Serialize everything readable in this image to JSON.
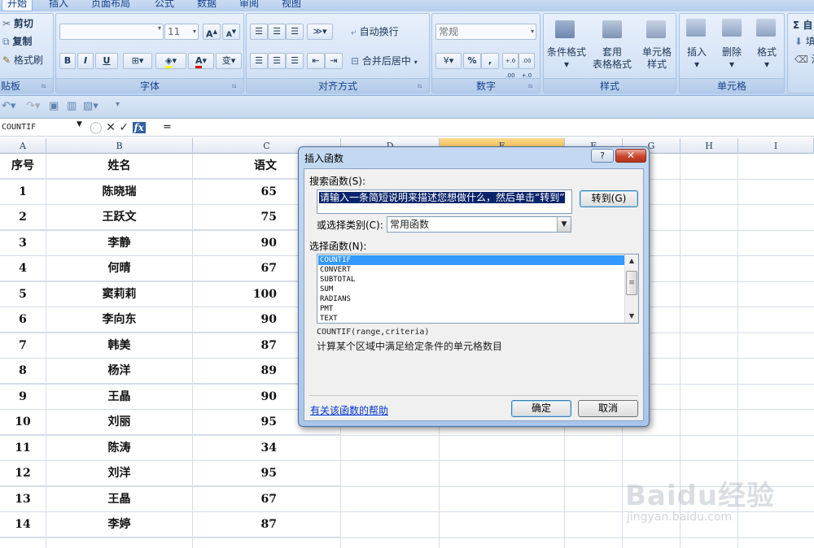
{
  "ribbon": {
    "tabs": [
      "开始",
      "插入",
      "页面布局",
      "公式",
      "数据",
      "审阅",
      "视图"
    ],
    "clipboard": {
      "cut": "剪切",
      "copy": "复制",
      "format_painter": "格式刷",
      "label": "贴板"
    },
    "font": {
      "label": "字体",
      "size": "11",
      "bold": "B",
      "italic": "I",
      "underline": "U",
      "grow": "A",
      "shrink": "A",
      "font_color": "A",
      "phonetic": "变"
    },
    "alignment": {
      "label": "对齐方式",
      "wrap_text": "自动换行",
      "merge_center": "合并后居中"
    },
    "number": {
      "label": "数字",
      "format": "常规",
      "percent": "%",
      "comma": ",",
      "inc_decimal": "+.0 .00",
      "dec_decimal": ".00 +.0"
    },
    "styles": {
      "label": "样式",
      "conditional": "条件格式",
      "table_format": "套用\n表格格式",
      "cell_styles": "单元格\n样式"
    },
    "cells": {
      "label": "单元格",
      "insert": "插入",
      "delete": "删除",
      "format": "格式"
    },
    "editing": {
      "sum": "Σ 自",
      "fill": "填",
      "clear": "清"
    }
  },
  "formula_bar": {
    "name_box": "COUNTIF",
    "formula": "="
  },
  "grid": {
    "columns": [
      "A",
      "B",
      "C",
      "D",
      "E",
      "F",
      "G",
      "H",
      "I"
    ],
    "header_row": [
      "序号",
      "姓名",
      "语文"
    ],
    "rows": [
      [
        "1",
        "陈晓瑞",
        "65"
      ],
      [
        "2",
        "王跃文",
        "75"
      ],
      [
        "3",
        "李静",
        "90"
      ],
      [
        "4",
        "何晴",
        "67"
      ],
      [
        "5",
        "窦莉莉",
        "100"
      ],
      [
        "6",
        "李向东",
        "90"
      ],
      [
        "7",
        "韩美",
        "87"
      ],
      [
        "8",
        "杨洋",
        "89"
      ],
      [
        "9",
        "王晶",
        "90"
      ],
      [
        "10",
        "刘丽",
        "95"
      ],
      [
        "11",
        "陈涛",
        "34"
      ],
      [
        "12",
        "刘洋",
        "95"
      ],
      [
        "13",
        "王晶",
        "67"
      ],
      [
        "14",
        "李婷",
        "87"
      ]
    ]
  },
  "dialog": {
    "title": "插入函数",
    "help_button": "?",
    "close_button": "✕",
    "search_label": "搜索函数(S):",
    "search_value": "请输入一条简短说明来描述您想做什么，然后单击“转到”",
    "go_button": "转到(G)",
    "category_label": "或选择类别(C):",
    "category_value": "常用函数",
    "function_list_label": "选择函数(N):",
    "functions": [
      "COUNTIF",
      "CONVERT",
      "SUBTOTAL",
      "SUM",
      "RADIANS",
      "PMT",
      "TEXT"
    ],
    "selected_function": "COUNTIF",
    "signature": "COUNTIF(range,criteria)",
    "description": "计算某个区域中满足给定条件的单元格数目",
    "help_link": "有关该函数的帮助",
    "ok_button": "确定",
    "cancel_button": "取消"
  },
  "watermark": {
    "brand": "Baidu经验",
    "url": "jingyan.baidu.com"
  }
}
